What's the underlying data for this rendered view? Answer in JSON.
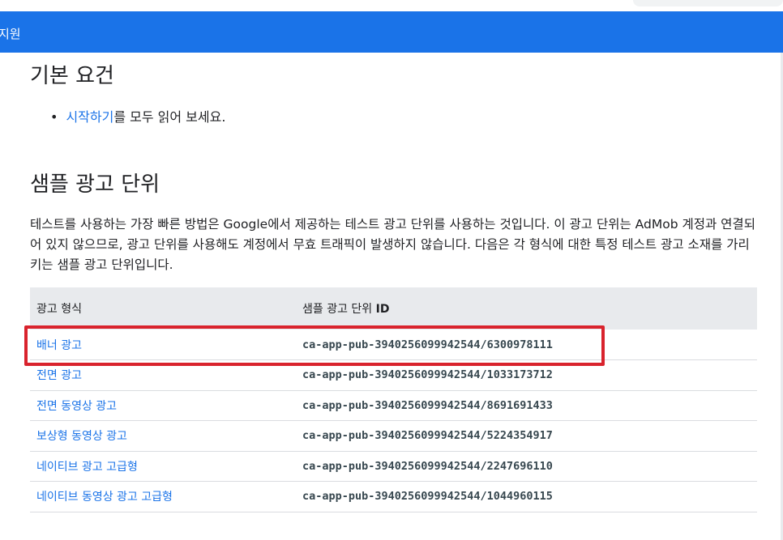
{
  "header": {
    "bar_text": "지원"
  },
  "sections": {
    "basic": {
      "title": "기본 요건",
      "bullet_link": "시작하기",
      "bullet_rest": "를 모두 읽어 보세요."
    },
    "sample": {
      "title": "샘플 광고 단위",
      "paragraph": "테스트를 사용하는 가장 빠른 방법은 Google에서 제공하는 테스트 광고 단위를 사용하는 것입니다. 이 광고 단위는 AdMob 계정과 연결되어 있지 않으므로, 광고 단위를 사용해도 계정에서 무효 트래픽이 발생하지 않습니다. 다음은 각 형식에 대한 특정 테스트 광고 소재를 가리키는 샘플 광고 단위입니다."
    }
  },
  "table": {
    "headers": [
      "광고 형식",
      "샘플 광고 단위",
      "ID"
    ],
    "rows": [
      {
        "format": "배너 광고",
        "id": "ca-app-pub-3940256099942544/6300978111"
      },
      {
        "format": "전면 광고",
        "id": "ca-app-pub-3940256099942544/1033173712"
      },
      {
        "format": "전면 동영상 광고",
        "id": "ca-app-pub-3940256099942544/8691691433"
      },
      {
        "format": "보상형 동영상 광고",
        "id": "ca-app-pub-3940256099942544/5224354917"
      },
      {
        "format": "네이티브 광고 고급형",
        "id": "ca-app-pub-3940256099942544/2247696110"
      },
      {
        "format": "네이티브 동영상 광고 고급형",
        "id": "ca-app-pub-3940256099942544/1044960115"
      }
    ]
  },
  "colors": {
    "brand_blue": "#1a73e8",
    "highlight_red": "#d9232d"
  }
}
